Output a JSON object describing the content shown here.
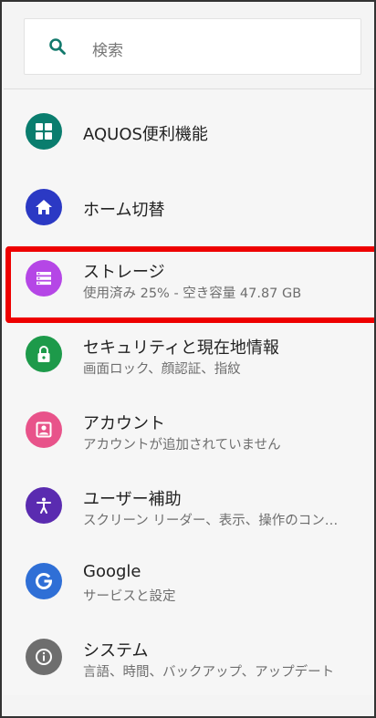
{
  "search": {
    "placeholder": "検索"
  },
  "items": [
    {
      "title": "AQUOS便利機能",
      "subtitle": "",
      "icon": "grid-icon",
      "color": "#0a7d6e"
    },
    {
      "title": "ホーム切替",
      "subtitle": "",
      "icon": "home-icon",
      "color": "#2b39c4"
    },
    {
      "title": "ストレージ",
      "subtitle": "使用済み 25% - 空き容量 47.87 GB",
      "icon": "storage-icon",
      "color": "#b546e6"
    },
    {
      "title": "セキュリティと現在地情報",
      "subtitle": "画面ロック、顔認証、指紋",
      "icon": "lock-icon",
      "color": "#1d9a4a"
    },
    {
      "title": "アカウント",
      "subtitle": "アカウントが追加されていません",
      "icon": "account-icon",
      "color": "#e8538a"
    },
    {
      "title": "ユーザー補助",
      "subtitle": "スクリーン リーダー、表示、操作のコン…",
      "icon": "accessibility-icon",
      "color": "#5a2bb0"
    },
    {
      "title": "Google",
      "subtitle": "サービスと設定",
      "icon": "google-icon",
      "color": "#2f6fd6"
    },
    {
      "title": "システム",
      "subtitle": "言語、時間、バックアップ、アップデート",
      "icon": "info-icon",
      "color": "#6e6e6e"
    }
  ],
  "highlight_color": "#ee0000"
}
